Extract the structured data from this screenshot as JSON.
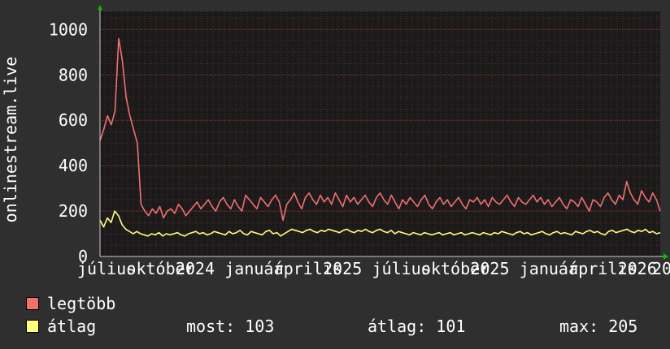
{
  "chart_data": {
    "type": "line",
    "ylabel": "onlinestream.live",
    "ylim": [
      0,
      1080
    ],
    "y_ticks": [
      0,
      200,
      400,
      600,
      800,
      1000
    ],
    "x_tick_labels": [
      "július",
      "október",
      "2024",
      "január",
      "április",
      "2025",
      "július",
      "október",
      "2025",
      "január",
      "április",
      "2026",
      "20"
    ],
    "grid": true,
    "series": [
      {
        "name": "legtöbb",
        "color": "#f07070",
        "values": [
          510,
          560,
          620,
          580,
          640,
          960,
          860,
          700,
          620,
          560,
          500,
          230,
          200,
          180,
          210,
          190,
          220,
          170,
          200,
          210,
          190,
          230,
          210,
          180,
          200,
          220,
          240,
          210,
          230,
          250,
          220,
          200,
          240,
          260,
          230,
          210,
          250,
          220,
          200,
          270,
          250,
          230,
          210,
          260,
          240,
          220,
          250,
          270,
          240,
          160,
          230,
          250,
          280,
          240,
          210,
          260,
          280,
          250,
          230,
          270,
          240,
          260,
          230,
          280,
          250,
          220,
          270,
          240,
          260,
          230,
          250,
          270,
          240,
          220,
          260,
          280,
          250,
          230,
          270,
          240,
          210,
          250,
          230,
          260,
          240,
          220,
          250,
          270,
          230,
          210,
          240,
          260,
          230,
          250,
          220,
          240,
          260,
          230,
          210,
          250,
          240,
          260,
          230,
          250,
          220,
          260,
          240,
          230,
          250,
          270,
          240,
          220,
          260,
          240,
          230,
          250,
          270,
          240,
          260,
          230,
          250,
          220,
          240,
          260,
          230,
          210,
          250,
          240,
          220,
          260,
          230,
          200,
          250,
          240,
          220,
          260,
          280,
          250,
          230,
          270,
          250,
          330,
          280,
          250,
          230,
          290,
          260,
          240,
          280,
          250,
          200
        ]
      },
      {
        "name": "átlag",
        "color": "#ffff80",
        "values": [
          160,
          130,
          170,
          150,
          200,
          180,
          140,
          120,
          110,
          100,
          110,
          100,
          95,
          90,
          100,
          95,
          105,
          90,
          100,
          95,
          100,
          105,
          95,
          90,
          100,
          105,
          110,
          100,
          105,
          95,
          100,
          110,
          105,
          100,
          95,
          110,
          100,
          105,
          115,
          100,
          95,
          110,
          105,
          100,
          95,
          110,
          115,
          100,
          105,
          90,
          100,
          110,
          120,
          115,
          110,
          105,
          115,
          120,
          110,
          105,
          115,
          110,
          120,
          115,
          110,
          105,
          115,
          120,
          110,
          105,
          115,
          110,
          120,
          110,
          105,
          115,
          120,
          110,
          105,
          115,
          100,
          110,
          105,
          100,
          95,
          105,
          100,
          95,
          105,
          100,
          95,
          100,
          105,
          95,
          100,
          105,
          95,
          100,
          105,
          95,
          100,
          105,
          100,
          95,
          105,
          100,
          95,
          105,
          100,
          110,
          105,
          100,
          95,
          105,
          110,
          100,
          105,
          95,
          100,
          105,
          110,
          100,
          95,
          105,
          110,
          100,
          105,
          100,
          95,
          110,
          105,
          100,
          110,
          115,
          105,
          110,
          100,
          95,
          110,
          115,
          105,
          110,
          115,
          120,
          110,
          105,
          115,
          110,
          120,
          105,
          110,
          100,
          105
        ]
      }
    ]
  },
  "legend": {
    "max_label": "legtöbb",
    "avg_label": "átlag",
    "current": "most: 103",
    "average": "átlag: 101",
    "maximum": "max: 205"
  },
  "colors": {
    "background": "#2f2f2f",
    "plot_background": "#1a1a1a",
    "grid": "#5a2a2a",
    "axis_arrow": "#00c000"
  }
}
